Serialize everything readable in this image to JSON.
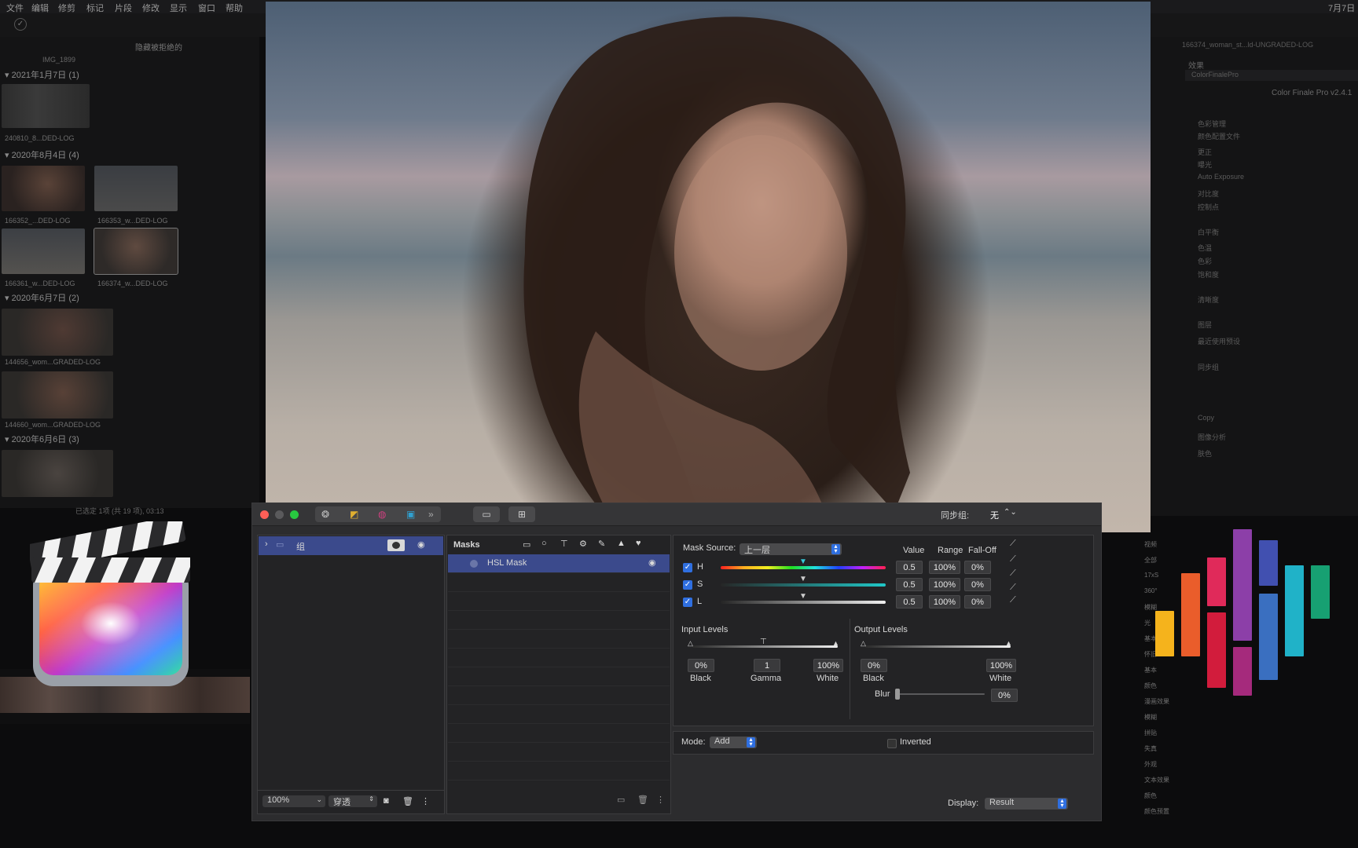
{
  "menubar": {
    "items": [
      "文件",
      "编辑",
      "修剪",
      "标记",
      "片段",
      "修改",
      "显示",
      "窗口",
      "帮助"
    ],
    "clock": "7月7日"
  },
  "browser": {
    "hide_rejected": "隐藏被拒绝的",
    "top_clip": "IMG_1899",
    "groups": [
      {
        "date": "2021年1月7日",
        "count": "(1)",
        "clips": [
          "240810_8...DED-LOG"
        ]
      },
      {
        "date": "2020年8月4日",
        "count": "(4)",
        "clips": [
          "166352_...DED-LOG",
          "166353_w...DED-LOG",
          "166361_w...DED-LOG",
          "166374_w...DED-LOG"
        ]
      },
      {
        "date": "2020年6月7日",
        "count": "(2)",
        "clips": [
          "144656_wom...GRADED-LOG",
          "144660_wom...GRADED-LOG"
        ]
      },
      {
        "date": "2020年6月6日",
        "count": "(3)",
        "clips": []
      }
    ],
    "selection_info": "已选定 1项 (共 19 项), 03:13"
  },
  "inspector": {
    "clip_title": "166374_woman_st...ld-UNGRADED-LOG",
    "effects_label": "效果",
    "plugin_name": "ColorFinalePro",
    "plugin_version": "Color Finale Pro v2.4.1",
    "rows": [
      "色彩管理",
      "颜色配置文件",
      "更正",
      "曝光",
      "Auto Exposure",
      "对比度",
      "控制点",
      "白平衡",
      "色温",
      "色彩",
      "饱和度",
      "清晰度",
      "图层",
      "最近使用预设",
      "同步组",
      "Copy",
      "图像分析",
      "肤色"
    ]
  },
  "side_categories": [
    "视频",
    "全部",
    "17xS",
    "360°",
    "模糊",
    "光",
    "基本",
    "怀旧",
    "基本",
    "颜色",
    "漫画效果",
    "模糊",
    "拼贴",
    "失真",
    "外观",
    "文本效果",
    "颜色",
    "颜色预置"
  ],
  "panel": {
    "sync_label": "同步组:",
    "sync_value": "无",
    "layers": {
      "group_name": "组",
      "zoom": "100%",
      "blend": "穿透"
    },
    "masks": {
      "title": "Masks",
      "items": [
        {
          "name": "HSL Mask"
        }
      ]
    },
    "mask_settings": {
      "source_label": "Mask Source:",
      "source_value": "上一层",
      "col_value": "Value",
      "col_range": "Range",
      "col_falloff": "Fall-Off",
      "rows": [
        {
          "name": "H",
          "value": "0.5",
          "range": "100%",
          "falloff": "0%",
          "checked": true
        },
        {
          "name": "S",
          "value": "0.5",
          "range": "100%",
          "falloff": "0%",
          "checked": true
        },
        {
          "name": "L",
          "value": "0.5",
          "range": "100%",
          "falloff": "0%",
          "checked": true
        }
      ],
      "input_levels": {
        "title": "Input Levels",
        "black": "0%",
        "gamma": "1",
        "white": "100%",
        "black_lbl": "Black",
        "gamma_lbl": "Gamma",
        "white_lbl": "White"
      },
      "output_levels": {
        "title": "Output Levels",
        "black": "0%",
        "white": "100%",
        "black_lbl": "Black",
        "white_lbl": "White"
      },
      "blur_label": "Blur",
      "blur_value": "0%",
      "mode_label": "Mode:",
      "mode_value": "Add",
      "inverted_label": "Inverted",
      "display_label": "Display:",
      "display_value": "Result"
    }
  },
  "colors": {
    "accent_blue": "#2f6fe0",
    "selected_row": "#3b4a8c",
    "bars": [
      "#f5b31c",
      "#ea5d2b",
      "#e02a5a",
      "#d21c3c",
      "#8c3fa8",
      "#a52a7c",
      "#4150b0",
      "#3a6fc0",
      "#20b2c8",
      "#17a072"
    ]
  }
}
